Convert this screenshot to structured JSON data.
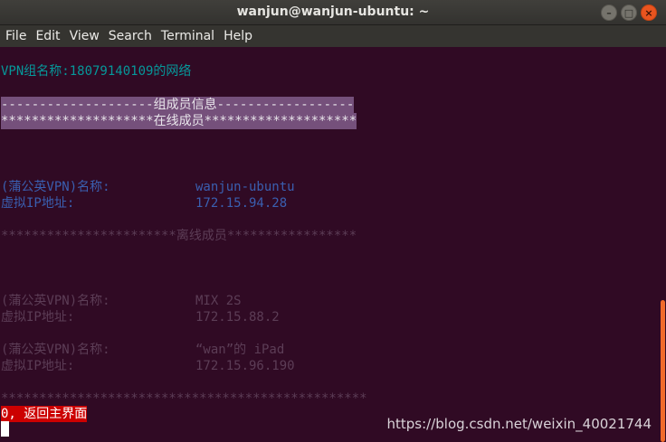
{
  "window": {
    "title": "wanjun@wanjun-ubuntu: ~",
    "buttons": [
      "–",
      "□",
      "×"
    ]
  },
  "menu": [
    "File",
    "Edit",
    "View",
    "Search",
    "Terminal",
    "Help"
  ],
  "terminal": {
    "vpn_group_line": "VPN组名称:18079140109的网络",
    "members_header": "--------------------组成员信息------------------",
    "online_header": "********************在线成员********************",
    "online": [
      {
        "name_label": "(蒲公英VPN)名称:",
        "name": "wanjun-ubuntu",
        "ip_label": "虚拟IP地址:",
        "ip": "172.15.94.28"
      }
    ],
    "offline_header": "***********************离线成员*****************",
    "offline": [
      {
        "name_label": "(蒲公英VPN)名称:",
        "name": "MIX 2S",
        "ip_label": "虚拟IP地址:",
        "ip": "172.15.88.2"
      },
      {
        "name_label": "(蒲公英VPN)名称:",
        "name": "“wan”的 iPad",
        "ip_label": "虚拟IP地址:",
        "ip": "172.15.96.190"
      }
    ],
    "footer_stars": "************************************************",
    "return_option": "0, 返回主界面"
  },
  "watermark": "https://blog.csdn.net/weixin_40021744",
  "colors": {
    "background": "#300a24",
    "highlight": "#75507b",
    "cyan": "#06989a",
    "blue": "#3a5fb0",
    "red": "#cc0000",
    "scroll_thumb": "#f06a2a"
  }
}
